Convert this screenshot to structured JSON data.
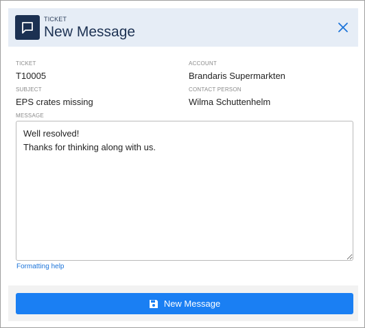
{
  "header": {
    "kicker": "TICKET",
    "title": "New Message",
    "icon": "message-square-icon",
    "close_icon": "close-icon"
  },
  "fields": {
    "ticket": {
      "label": "TICKET",
      "value": "T10005"
    },
    "account": {
      "label": "ACCOUNT",
      "value": "Brandaris Supermarkten"
    },
    "subject": {
      "label": "SUBJECT",
      "value": "EPS crates missing"
    },
    "contact": {
      "label": "CONTACT PERSON",
      "value": "Wilma Schuttenhelm"
    },
    "message": {
      "label": "MESSAGE",
      "value": "Well resolved!\nThanks for thinking along with us."
    }
  },
  "formatting_help": "Formatting help",
  "footer": {
    "button_label": "New Message",
    "button_icon": "save-icon"
  },
  "colors": {
    "header_bg": "#e6edf6",
    "icon_bg": "#1c3152",
    "accent": "#1a7ff3",
    "link": "#1a73d9"
  }
}
